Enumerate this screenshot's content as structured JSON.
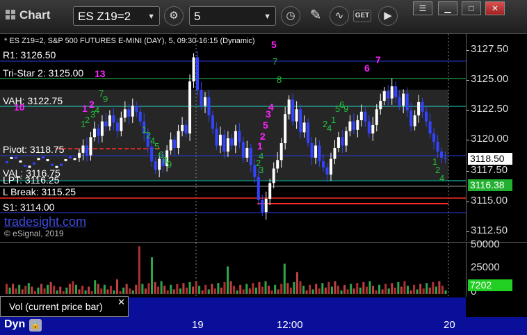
{
  "window": {
    "title": "Chart",
    "symbol": "ES Z19=2",
    "interval": "5"
  },
  "chart": {
    "description": "* ES Z19=2, S&P 500 FUTURES E-MINI (DAY), 5, 09:30-16:15 (Dynamic)",
    "watermark": "tradesight.com",
    "copyright": "© eSignal, 2019",
    "levels": {
      "r1": "R1: 3126.50",
      "tristar": "Tri-Star 2: 3125.00",
      "vah": "VAH: 3122.75",
      "pivot": "Pivot: 3118.75",
      "val": "VAL: 3116.75",
      "lpt": "LPT: 3116.25",
      "lbreak": "L Break: 3115.25",
      "s1": "S1: 3114.00"
    },
    "price_axis": [
      "3127.50",
      "3125.00",
      "3122.50",
      "3120.00",
      "3117.50",
      "3115.00",
      "3112.50"
    ],
    "last_price": "3118.50",
    "lpt_price": "3116.38",
    "colors": {
      "up": "#ffffff",
      "down": "#3344ff",
      "count_green": "#23c23a",
      "count_magenta": "#ff22ff"
    }
  },
  "volume": {
    "axis": [
      "50000",
      "25000",
      "0"
    ],
    "current": "7202",
    "label": "Vol (current price bar)"
  },
  "time_axis": [
    "19",
    "12:00",
    "20"
  ],
  "dyn": "Dyn"
}
